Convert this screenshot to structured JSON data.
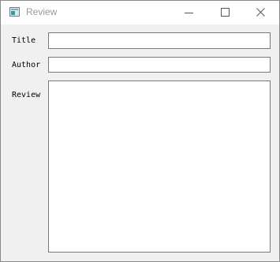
{
  "window": {
    "title": "Review"
  },
  "form": {
    "title_label": "Title",
    "title_value": "",
    "author_label": "Author",
    "author_value": "",
    "review_label": "Review",
    "review_value": ""
  },
  "icons": {
    "app": "window-app-icon",
    "minimize": "minimize-icon",
    "maximize": "maximize-icon",
    "close": "close-icon"
  }
}
